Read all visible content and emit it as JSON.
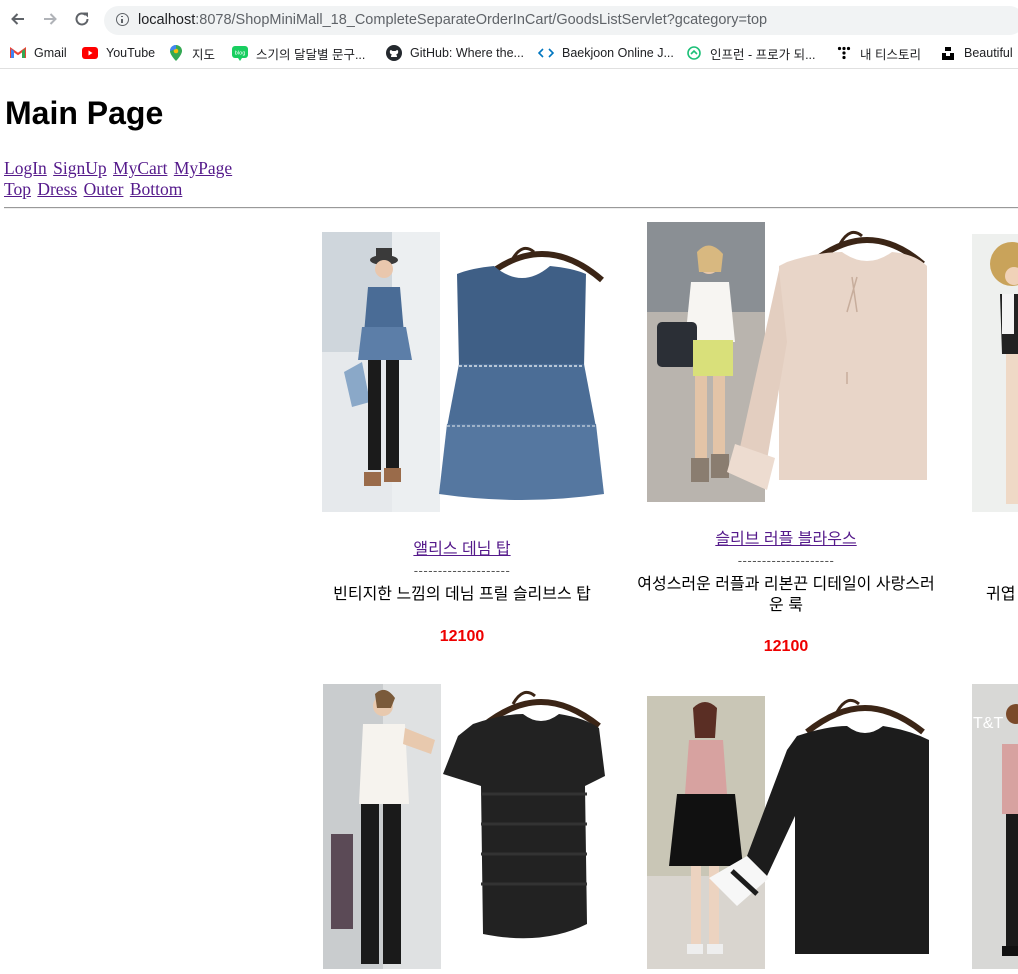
{
  "browser": {
    "url_host": "localhost",
    "url_rest": ":8078/ShopMiniMall_18_CompleteSeparateOrderInCart/GoodsListServlet?gcategory=top",
    "bookmarks": [
      {
        "label": "Gmail",
        "icon": "gmail-icon"
      },
      {
        "label": "YouTube",
        "icon": "youtube-icon"
      },
      {
        "label": "지도",
        "icon": "maps-icon"
      },
      {
        "label": "스기의 달달별 문구...",
        "icon": "blog-icon"
      },
      {
        "label": "GitHub: Where the...",
        "icon": "github-icon"
      },
      {
        "label": "Baekjoon Online J...",
        "icon": "code-icon"
      },
      {
        "label": "인프런 - 프로가 되...",
        "icon": "inflearn-icon"
      },
      {
        "label": "내 티스토리",
        "icon": "tistory-icon"
      },
      {
        "label": "Beautiful",
        "icon": "unsplash-icon"
      }
    ]
  },
  "page": {
    "title": "Main Page",
    "nav1": [
      "LogIn",
      "SignUp",
      "MyCart",
      "MyPage"
    ],
    "nav2": [
      "Top",
      "Dress",
      "Outer",
      "Bottom"
    ]
  },
  "products": [
    {
      "name": "앨리스 데님 탑",
      "separator": "--------------------",
      "desc": "빈티지한 느낌의 데님 프릴 슬리브스 탑",
      "price": "12100"
    },
    {
      "name": "슬리브 러플 블라우스",
      "separator": "--------------------",
      "desc": "여성스러운 러플과 리본끈 디테일이 사랑스러운 룩",
      "price": "12100"
    },
    {
      "name": "",
      "separator": "",
      "desc": "귀엽",
      "price": ""
    },
    {
      "name": "",
      "separator": "",
      "desc": "",
      "price": ""
    },
    {
      "name": "",
      "separator": "",
      "desc": "",
      "price": ""
    },
    {
      "name": "",
      "separator": "",
      "desc": "",
      "price": ""
    }
  ],
  "colors": {
    "link": "#551a8b",
    "price": "#e00000",
    "chrome_bg": "#f1f3f4"
  }
}
